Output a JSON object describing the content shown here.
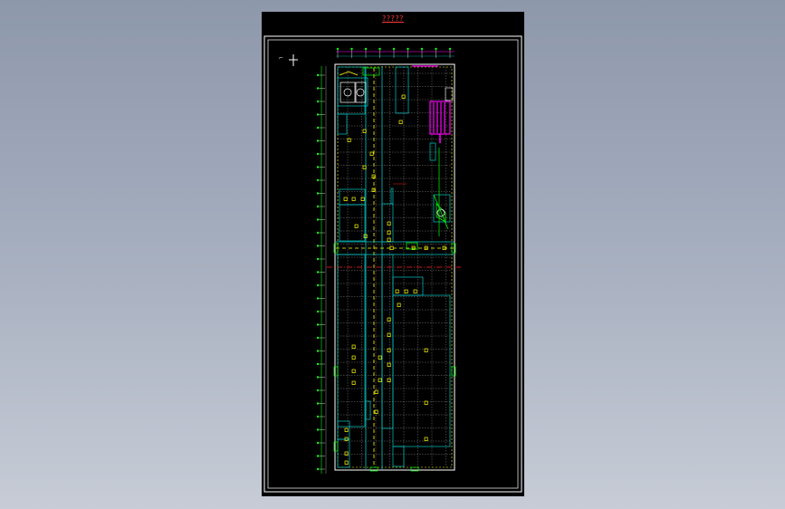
{
  "drawing": {
    "title": "?????",
    "colors": {
      "background": "#000000",
      "frame": "#ffffff",
      "walls": "#00c8c8",
      "grid": "#ffffff",
      "axis": "#00ff00",
      "labels": "#ffff00",
      "equipment": "#ff00ff",
      "section_line": "#ff2020"
    }
  }
}
